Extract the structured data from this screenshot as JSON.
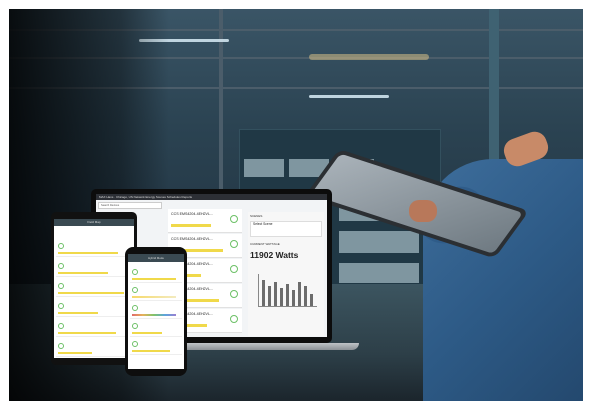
{
  "laptop": {
    "topbar": "MAX Hans · Chicago, US        Network   Energy   Scenes   Schedules   Reports",
    "search_placeholder": "Search Devices",
    "devices": [
      {
        "name": "CCS EMS4204-4EH2VL..."
      },
      {
        "name": "CCS EMS4204-4EH2VL..."
      },
      {
        "name": "CCS EMS4204-4EH2VL..."
      },
      {
        "name": "CCS EMS4204-4EH2VL..."
      },
      {
        "name": "CCS EMS4204-4EH2VL..."
      }
    ],
    "panel": {
      "section_label": "SCENES",
      "select_scene": "Select Scene",
      "current_label": "CURRENT WATTAGE",
      "watts": "11902 Watts"
    }
  },
  "tablet": {
    "title": "Field Map"
  },
  "phone": {
    "title": "Hybrid Mode"
  },
  "colors": {
    "accent_yellow": "#f0d94a",
    "accent_green": "#6cc066",
    "sleeve_blue": "#2d5a86"
  }
}
